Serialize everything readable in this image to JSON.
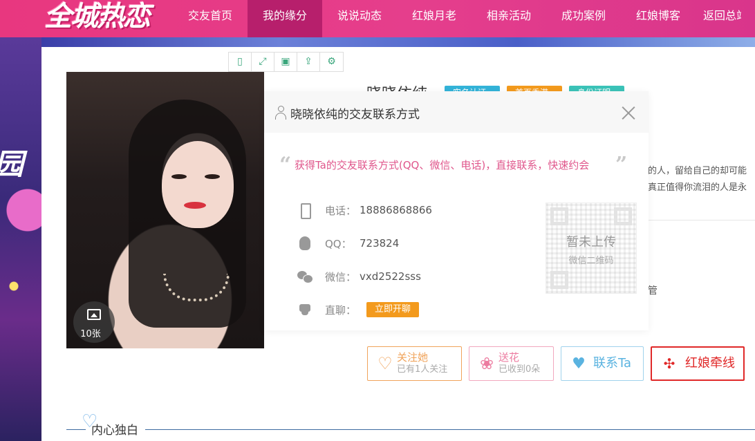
{
  "header": {
    "logo_text": "全城热恋",
    "nav": [
      {
        "label": "交友首页",
        "active": false
      },
      {
        "label": "我的缘分",
        "active": true
      },
      {
        "label": "说说动态",
        "active": false
      },
      {
        "label": "红娘月老",
        "active": false
      },
      {
        "label": "相亲活动",
        "active": false
      },
      {
        "label": "成功案例",
        "active": false
      },
      {
        "label": "红娘博客",
        "active": false
      },
      {
        "label": "返回总站",
        "active": false
      }
    ]
  },
  "background": {
    "side_text": "园"
  },
  "profile": {
    "photo_count": "10张",
    "name": "晓晓依纯",
    "tags": [
      "实名认证",
      "首页香港",
      "身份证明"
    ],
    "intro_lines": [
      "的人，留给自己的却可能",
      "真正值得你流泪的人是永"
    ],
    "extra_text": "管",
    "actions": {
      "follow": {
        "main": "关注她",
        "sub": "已有1人关注"
      },
      "flower": {
        "main": "送花",
        "sub": "已收到0朵"
      },
      "contact": {
        "main": "联系Ta"
      },
      "matchmaker": {
        "main": "红娘牵线"
      }
    },
    "section_title": "内心独白"
  },
  "toolbar": {
    "icons": [
      "mobile-icon",
      "fullscreen-icon",
      "save-icon",
      "share-icon",
      "settings-icon"
    ],
    "glyphs": [
      "▯",
      "⤢",
      "▣",
      "⇪",
      "⚙"
    ]
  },
  "modal": {
    "title": "晓晓依纯的交友联系方式",
    "tagline": "获得Ta的交友联系方式(QQ、微信、电话)，直接联系，快速约会",
    "quote_open": "“",
    "quote_close": "”",
    "phone": {
      "label": "电话：",
      "value": "18886868866"
    },
    "qq": {
      "label": "QQ：",
      "value": "723824"
    },
    "wechat": {
      "label": "微信：",
      "value": "vxd2522sss"
    },
    "chat": {
      "label": "直聊：",
      "button": "立即开聊"
    },
    "qr": {
      "main": "暂未上传",
      "sub": "微信二维码"
    }
  },
  "colors": {
    "brand": "#e8377f",
    "nav_active": "#b71f6c",
    "accent_orange": "#f39a1d",
    "tagline_pink": "#e0578c"
  }
}
